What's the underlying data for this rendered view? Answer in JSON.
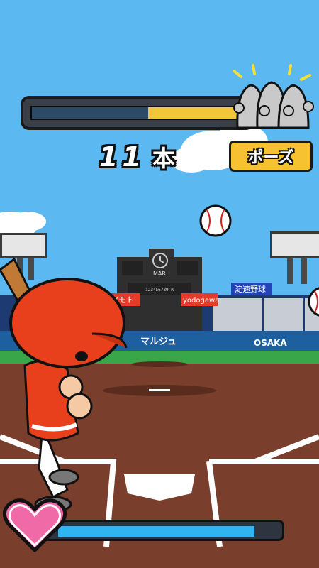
{
  "hud": {
    "homerun_progress": 0.45,
    "count_number": "11",
    "count_unit": "本",
    "pause_label": "ポーズ",
    "life_level": 0.89
  },
  "stadium": {
    "scoreboard_label": "MAR",
    "scoreboard_digits": "123456789 R",
    "ad_left": "アツモト",
    "ad_right": "yodogawa",
    "ad_banner": "淀速野球",
    "wall_text_left": "マルジュ",
    "wall_text_right": "OSAKA"
  },
  "icons": {
    "crowd": "crowd-icon",
    "heart": "heart-icon",
    "ball": "baseball-icon",
    "batter": "batter-character"
  },
  "colors": {
    "sky": "#5bb8f0",
    "grass": "#3aa64a",
    "dirt": "#7a3f2c",
    "progress_fill": "#f3c53a",
    "life_fill": "#2fb5ef",
    "pause_button": "#f7c232",
    "heart": "#f06aa8",
    "batter_uniform": "#e8401d"
  }
}
